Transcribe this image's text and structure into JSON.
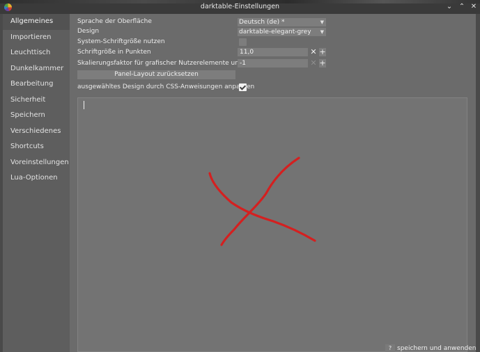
{
  "window": {
    "title": "darktable-Einstellungen",
    "controls": {
      "minimize": "⌄",
      "maximize": "⌃",
      "close": "✕"
    }
  },
  "sidebar": {
    "items": [
      {
        "label": "Allgemeines",
        "active": true
      },
      {
        "label": "Importieren"
      },
      {
        "label": "Leuchttisch"
      },
      {
        "label": "Dunkelkammer"
      },
      {
        "label": "Bearbeitung"
      },
      {
        "label": "Sicherheit"
      },
      {
        "label": "Speichern"
      },
      {
        "label": "Verschiedenes"
      },
      {
        "label": "Shortcuts"
      },
      {
        "label": "Voreinstellungen"
      },
      {
        "label": "Lua-Optionen"
      }
    ]
  },
  "settings": {
    "language": {
      "label": "Sprache der Oberfläche",
      "value": "Deutsch (de) *"
    },
    "theme": {
      "label": "Design",
      "value": "darktable-elegant-grey"
    },
    "system_font": {
      "label": "System-Schriftgröße nutzen",
      "checked": false
    },
    "font_size": {
      "label": "Schriftgröße in Punkten",
      "value": "11,0"
    },
    "scale_factor": {
      "label": "Skalierungsfaktor für grafischer Nutzerelemente und Text",
      "value": "-1"
    },
    "reset_layout_button": "Panel-Layout zurücksetzen",
    "css_tweak": {
      "label": "ausgewähltes Design durch CSS-Anweisungen anpassen",
      "checked": true
    }
  },
  "footer": {
    "help_label": "?",
    "apply_label": "speichern und anwenden"
  },
  "icons": {
    "chevron": "chevron-down-icon",
    "clear": "clear-icon",
    "plus": "plus-icon",
    "annotation": "red-x-annotation"
  },
  "colors": {
    "annotation": "#d42020"
  }
}
